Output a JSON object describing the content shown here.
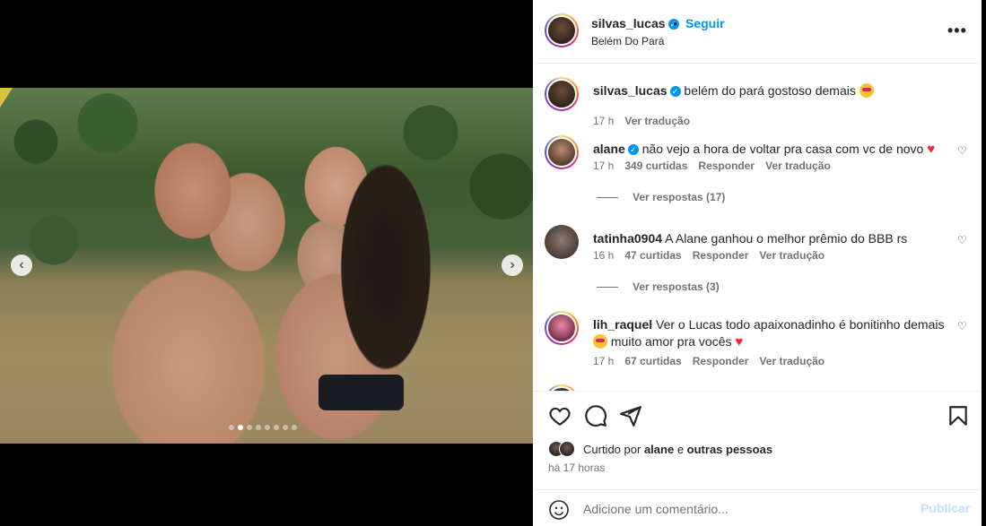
{
  "post": {
    "username": "silvas_lucas",
    "follow_label": "Seguir",
    "dot_separator": "•",
    "location": "Belém Do Pará",
    "more_label": "•••"
  },
  "carousel": {
    "total_slides": 8,
    "active_index": 1,
    "prev_label": "‹",
    "next_label": "›"
  },
  "caption": {
    "username": "silvas_lucas",
    "text": "belém do pará gostoso demais",
    "time": "17 h",
    "translate": "Ver tradução"
  },
  "comments": [
    {
      "username": "alane",
      "text": "não vejo a hora de voltar pra casa com vc de novo",
      "time": "17 h",
      "likes": "349 curtidas",
      "reply": "Responder",
      "translate": "Ver tradução",
      "view_replies": "Ver respostas (17)"
    },
    {
      "username": "tatinha0904",
      "text": "A Alane ganhou o melhor prêmio do BBB rs",
      "time": "16 h",
      "likes": "47 curtidas",
      "reply": "Responder",
      "translate": "Ver tradução",
      "view_replies": "Ver respostas (3)"
    },
    {
      "username": "lih_raquel",
      "text_line1": "Ver o Lucas todo apaixonadinho é bonitinho demais",
      "text_line2": "muito amor pra vocês",
      "time": "17 h",
      "likes": "67 curtidas",
      "reply": "Responder",
      "translate": "Ver tradução"
    }
  ],
  "likes": {
    "prefix": "Curtido por",
    "user": "alane",
    "conj": "e",
    "others": "outras pessoas",
    "time": "há 17 horas"
  },
  "add_comment": {
    "placeholder": "Adicione um comentário...",
    "publish_label": "Publicar"
  },
  "colors": {
    "accent": "#0095f6",
    "publish_disabled": "#c0dffd",
    "heart_red": "#ed2a3e"
  }
}
